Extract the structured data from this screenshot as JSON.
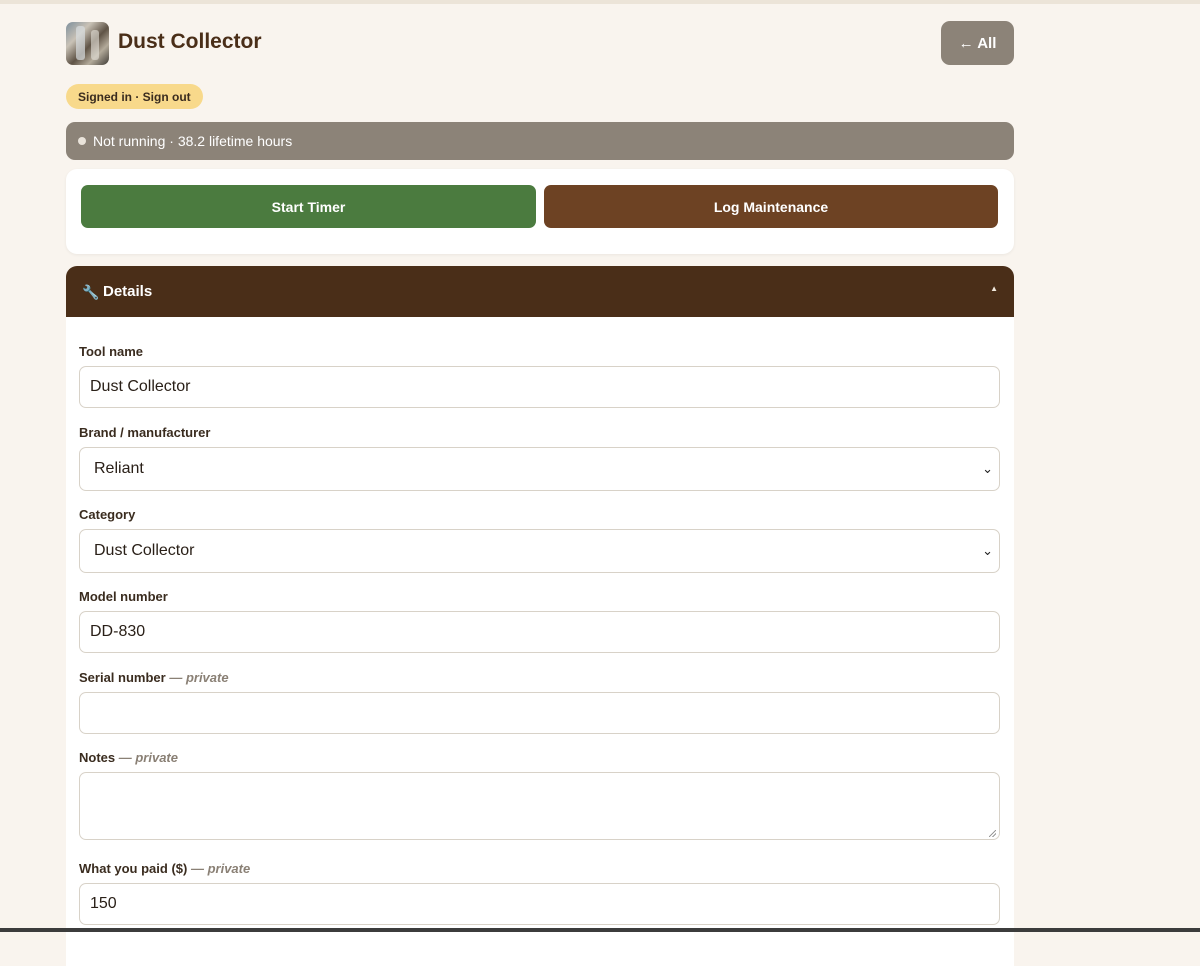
{
  "header": {
    "title": "Dust Collector",
    "back_label": "← All",
    "thumb_icon": "tool-photo-icon"
  },
  "auth": {
    "badge_label": "Signed in · Sign out"
  },
  "status": {
    "text": "Not running · 38.2 lifetime hours"
  },
  "actions": {
    "start_label": "Start Timer",
    "log_label": "Log Maintenance"
  },
  "details": {
    "title": "Details",
    "icon": "🔧",
    "collapse_glyph": "▲",
    "tool_name_label": "Tool name",
    "tool_name_value": "Dust Collector",
    "brand_label": "Brand / manufacturer",
    "brand_value": "Reliant",
    "category_label": "Category",
    "category_value": "Dust Collector",
    "model_label": "Model number",
    "model_value": "DD-830",
    "serial_label": "Serial number",
    "serial_note": "— private",
    "serial_value": "",
    "notes_label": "Notes",
    "notes_note": "— private",
    "notes_value": "",
    "paid_label": "What you paid ($)",
    "paid_note": "— private",
    "paid_value": "150"
  },
  "colors": {
    "background": "#f9f4ee",
    "start_green": "#4b7b3f",
    "log_brown": "#6d4223",
    "header_brown": "#4a2e18",
    "status_gray": "#8c8378",
    "badge_yellow": "#f8d98b"
  }
}
